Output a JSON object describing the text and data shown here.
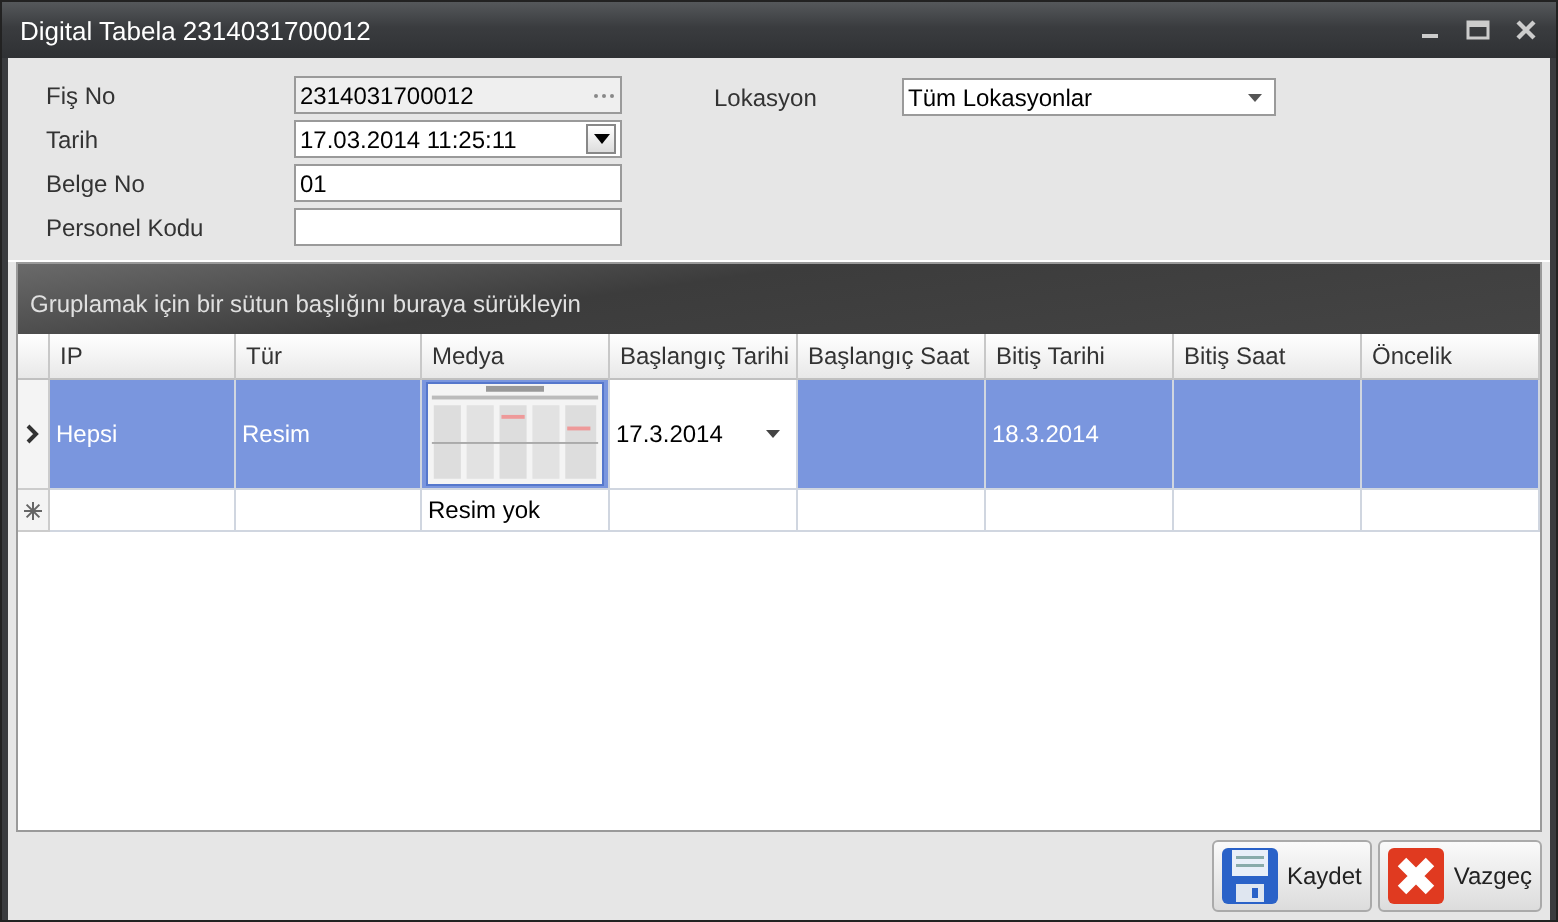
{
  "window": {
    "title": "Digital Tabela 2314031700012"
  },
  "form": {
    "fields": [
      {
        "label": "Fiş No",
        "kind": "ellipsis",
        "value": "2314031700012",
        "readonly": true
      },
      {
        "label": "Tarih",
        "kind": "dropdown",
        "value": "17.03.2014 11:25:11",
        "readonly": false
      },
      {
        "label": "Belge No",
        "kind": "text",
        "value": "01",
        "readonly": false
      },
      {
        "label": "Personel Kodu",
        "kind": "text",
        "readonly": false
      }
    ],
    "location": {
      "label": "Lokasyon",
      "value": "Tüm Lokasyonlar"
    }
  },
  "grid": {
    "group_panel": "Gruplamak için bir sütun başlığını buraya sürükleyin",
    "columns": [
      "IP",
      "Tür",
      "Medya",
      "Başlangıç Tarihi",
      "Başlangıç Saat",
      "Bitiş Tarihi",
      "Bitiş Saat",
      "Öncelik"
    ],
    "rows": [
      {
        "selected": true,
        "kind": "data",
        "cells": [
          {
            "text": "Hepsi"
          },
          {
            "text": "Resim"
          },
          {
            "kind": "picture"
          },
          {
            "text": "17.3.2014",
            "kind": "editor"
          },
          {},
          {
            "text": "18.3.2014"
          },
          {},
          {}
        ]
      },
      {
        "selected": false,
        "kind": "new",
        "cells": [
          {},
          {},
          {
            "text": "Resim yok"
          },
          {},
          {},
          {},
          {},
          {}
        ]
      }
    ]
  },
  "buttons": [
    {
      "label": "Kaydet",
      "kind": "save"
    },
    {
      "label": "Vazgeç",
      "kind": "cancel"
    }
  ]
}
